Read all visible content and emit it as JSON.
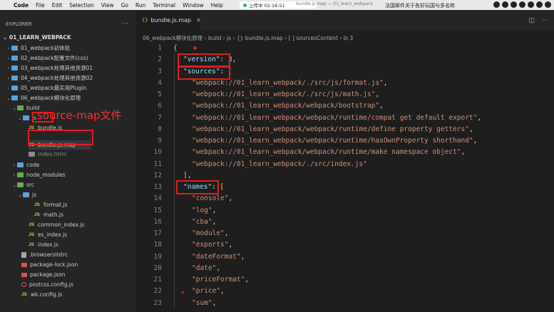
{
  "menubar": {
    "items": [
      "Code",
      "File",
      "Edit",
      "Selection",
      "View",
      "Go",
      "Run",
      "Terminal",
      "Window",
      "Help"
    ],
    "window_title": "bundle.js.map — 01_learn_webpack",
    "recording": "上传中 02:16:51",
    "marquee": "法国邮件关于各好玩国与多名称"
  },
  "sidebar": {
    "header": "EXPLORER",
    "project": "01_LEARN_WEBPACK",
    "items": [
      {
        "label": "01_webpack初体验",
        "type": "folder"
      },
      {
        "label": "02_webpack配置文件(css)",
        "type": "folder"
      },
      {
        "label": "03_webpack处理其他资源01",
        "type": "folder"
      },
      {
        "label": "04_webpack处理其他资源02",
        "type": "folder"
      },
      {
        "label": "05_webpack最实用Plugin",
        "type": "folder"
      },
      {
        "label": "06_webpack模块化原理",
        "type": "folder"
      },
      {
        "label": "build",
        "type": "folder"
      },
      {
        "label": "js",
        "type": "folder"
      },
      {
        "label": "bundle.js",
        "type": "js"
      },
      {
        "label": "bundle.js.map",
        "type": "js"
      },
      {
        "label": "index.html",
        "type": "file"
      },
      {
        "label": "code",
        "type": "folder"
      },
      {
        "label": "node_modules",
        "type": "folder"
      },
      {
        "label": "src",
        "type": "folder"
      },
      {
        "label": "js",
        "type": "folder"
      },
      {
        "label": "format.js",
        "type": "js"
      },
      {
        "label": "math.js",
        "type": "js"
      },
      {
        "label": "common_index.js",
        "type": "js"
      },
      {
        "label": "es_index.js",
        "type": "js"
      },
      {
        "label": "index.js",
        "type": "js"
      },
      {
        "label": ".browserslistrc",
        "type": "file"
      },
      {
        "label": "package-lock.json",
        "type": "pkg"
      },
      {
        "label": "package.json",
        "type": "pkg"
      },
      {
        "label": "postcss.config.js",
        "type": "cfg"
      },
      {
        "label": "wk.config.js",
        "type": "js"
      }
    ]
  },
  "annotation": {
    "text": "source-map文件"
  },
  "tab": {
    "label": "bundle.js.map",
    "icon": "{}"
  },
  "breadcrumb": "06_webpack模块化原理 › build › js › {} bundle.js.map › [ ] sourcesContent › ⊟ 3",
  "code": {
    "line_numbers": [
      "1",
      "2",
      "3",
      "4",
      "5",
      "6",
      "7",
      "8",
      "9",
      "10",
      "11",
      "12",
      "13",
      "14",
      "15",
      "16",
      "17",
      "18",
      "19",
      "20",
      "21",
      "22",
      "23"
    ],
    "version_key": "\"version\"",
    "version_value": "3",
    "sources_key": "\"sources\"",
    "sources": [
      "\"webpack://01_learn_webpack/./src/js/format.js\"",
      "\"webpack://01_learn_webpack/./src/js/math.js\"",
      "\"webpack://01_learn_webpack/webpack/bootstrap\"",
      "\"webpack://01_learn_webpack/webpack/runtime/compat get default export\"",
      "\"webpack://01_learn_webpack/webpack/runtime/define property getters\"",
      "\"webpack://01_learn_webpack/webpack/runtime/hasOwnProperty shorthand\"",
      "\"webpack://01_learn_webpack/webpack/runtime/make namespace object\"",
      "\"webpack://01_learn_webpack/./src/index.js\""
    ],
    "names_key": "\"names\"",
    "names": [
      "\"console\"",
      "\"log\"",
      "\"cba\"",
      "\"module\"",
      "\"exports\"",
      "\"dateFormat\"",
      "\"date\"",
      "\"priceFormat\"",
      "\"price\"",
      "\"sum\""
    ]
  }
}
